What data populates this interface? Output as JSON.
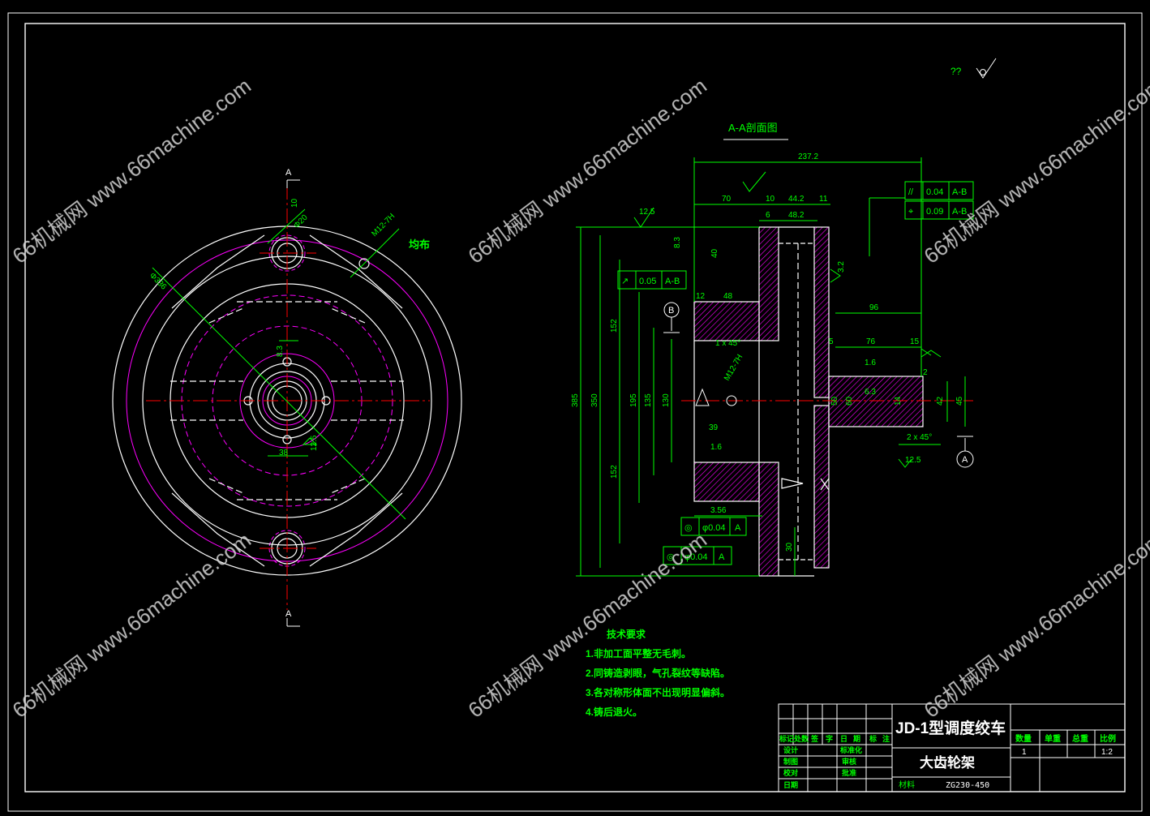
{
  "colors": {
    "background": "#000000",
    "white": "#ffffff",
    "green": "#00ff00",
    "magenta": "#ff00ff",
    "red": "#ff0000",
    "watermark": "#d8d8d8"
  },
  "watermark": {
    "text": "66机械网 www.66machine.com"
  },
  "marks": {
    "surface_qq": "??"
  },
  "front_view": {
    "section_label_a": "A",
    "annotation_jun_bu": "均布",
    "dim_bolt_hole": "M12-7H",
    "dim_phi20": "Φ20",
    "dim_phi336": "Φ336",
    "dim_38": "38",
    "dim_8_3": "8.3",
    "rough_12_5": "12.5",
    "rough_10": "10"
  },
  "section_view": {
    "title": "A-A剖面图",
    "overall_len": "237.2",
    "dims_top": [
      "70",
      "10",
      "44.2",
      "11",
      "48.2"
    ],
    "dim_small_6": "6",
    "dim_40": "40",
    "dim_8_3": "8.3",
    "dims_vertical_left": [
      "385",
      "350",
      "152",
      "195",
      "135",
      "130",
      "152"
    ],
    "dims_hub": [
      "12",
      "48"
    ],
    "dim_1x45": "1 x 45°",
    "dim_thread": "M12-7H",
    "dim_39": "39",
    "dim_3_56": "3.56",
    "dim_30": "30",
    "dim_96": "96",
    "dim_76": "76",
    "dim_15": "15",
    "dim_5": "5",
    "dim_2": "2",
    "dim_2x45": "2 x 45°",
    "shaft_dims": [
      "50",
      "60",
      "42",
      "45"
    ],
    "dim_14": "14",
    "rough_values": [
      "12.5",
      "6.3",
      "1.6",
      "3.2"
    ],
    "datum_a": "A",
    "datum_b": "B",
    "tolerance_frames": [
      {
        "symbol": "//",
        "value": "0.04",
        "datum": "A-B"
      },
      {
        "symbol": "⌖",
        "value": "0.09",
        "datum": "A-B"
      },
      {
        "symbol": "↗",
        "value": "0.05",
        "datum": "A-B"
      },
      {
        "symbol": "◎",
        "value": "φ0.04",
        "datum": "A"
      },
      {
        "symbol": "◎",
        "value": "φ0.04",
        "datum": "A"
      }
    ]
  },
  "tech_requirements": {
    "title": "技术要求",
    "items": [
      "1.非加工面平整无毛刺。",
      "2.同铸造剥眼，气孔裂纹等缺陷。",
      "3.各对称形体面不出现明显偏斜。",
      "4.铸后退火。"
    ]
  },
  "title_block": {
    "product": "JD-1型调度绞车",
    "part_name": "大齿轮架",
    "material_label": "材料",
    "material": "ZG230-450",
    "headers": [
      "数量",
      "单重",
      "总重",
      "比例"
    ],
    "quantity": "1",
    "scale": "1:2",
    "revision_headers": [
      "标记",
      "处数",
      "签",
      "字",
      "日",
      "期",
      "标",
      "注"
    ],
    "roles": [
      "设计",
      "制图",
      "校对",
      "日期"
    ],
    "roles_right": [
      "标准化",
      "审核",
      "批准"
    ]
  }
}
